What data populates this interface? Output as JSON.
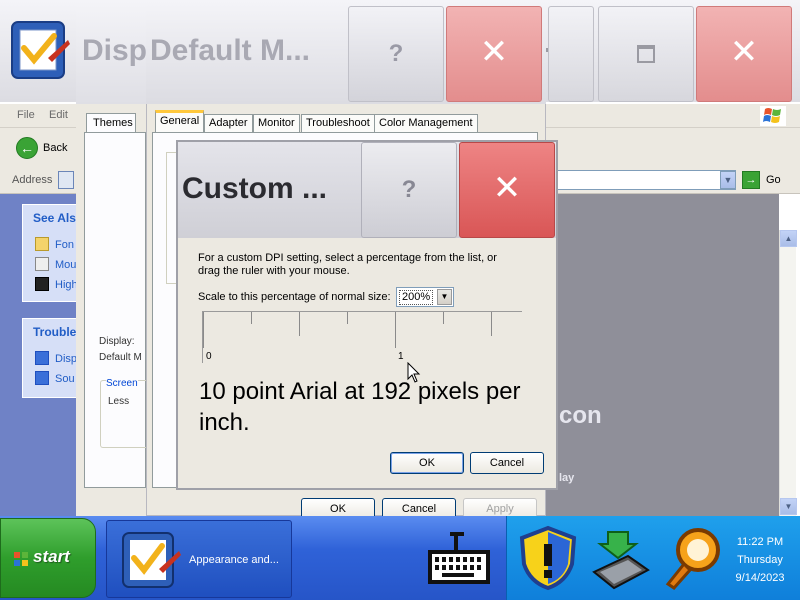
{
  "explorer": {
    "menu": [
      "File",
      "Edit"
    ],
    "back_label": "Back",
    "address_label": "Address",
    "go_label": "Go",
    "see_also": {
      "title": "See Als",
      "items": [
        "Fon",
        "Mou",
        "High"
      ]
    },
    "troubleshooters": {
      "title": "Trouble",
      "items": [
        "Disp",
        "Sou"
      ]
    },
    "content_watermark": "con",
    "content_watermark2": "lay"
  },
  "display_window": {
    "title": "Disp",
    "tab_themes": "Themes",
    "display_label": "Display:",
    "display_value": "Default M",
    "screen_legend": "Screen",
    "screen_value": "Less"
  },
  "monitor_window": {
    "title": "Default M...",
    "help": "?",
    "close": "✕",
    "tabs": [
      "General",
      "Adapter",
      "Monitor",
      "Troubleshoot",
      "Color Management"
    ],
    "active_tab": "General",
    "ok": "OK",
    "cancel": "Cancel",
    "apply": "Apply"
  },
  "dpi_dialog": {
    "title": "Custom ...",
    "help": "?",
    "close": "✕",
    "instructions": "For a custom DPI setting, select a percentage from the list, or drag the ruler with your mouse.",
    "scale_label": "Scale to this percentage of normal size:",
    "scale_value": "200%",
    "ruler_labels": [
      "0",
      "1"
    ],
    "sample_text": "10 point Arial at 192 pixels per inch.",
    "ok": "OK",
    "cancel": "Cancel"
  },
  "taskbar": {
    "start_label": "start",
    "task_label": "Appearance and...",
    "clock": {
      "time": "11:22 PM",
      "day": "Thursday",
      "date": "9/14/2023"
    }
  },
  "colors": {
    "close_red": "#d95656",
    "taskbar_blue": "#2f62d8",
    "start_green": "#2f9e2c",
    "tray_blue": "#0f7fda"
  },
  "icons": [
    "control-panel-icon",
    "windows-logo-icon",
    "back-arrow-icon",
    "go-arrow-icon",
    "folder-icon",
    "keyboard-icon",
    "security-shield-icon",
    "network-icon",
    "search-magnifier-icon",
    "mouse-cursor-icon"
  ]
}
